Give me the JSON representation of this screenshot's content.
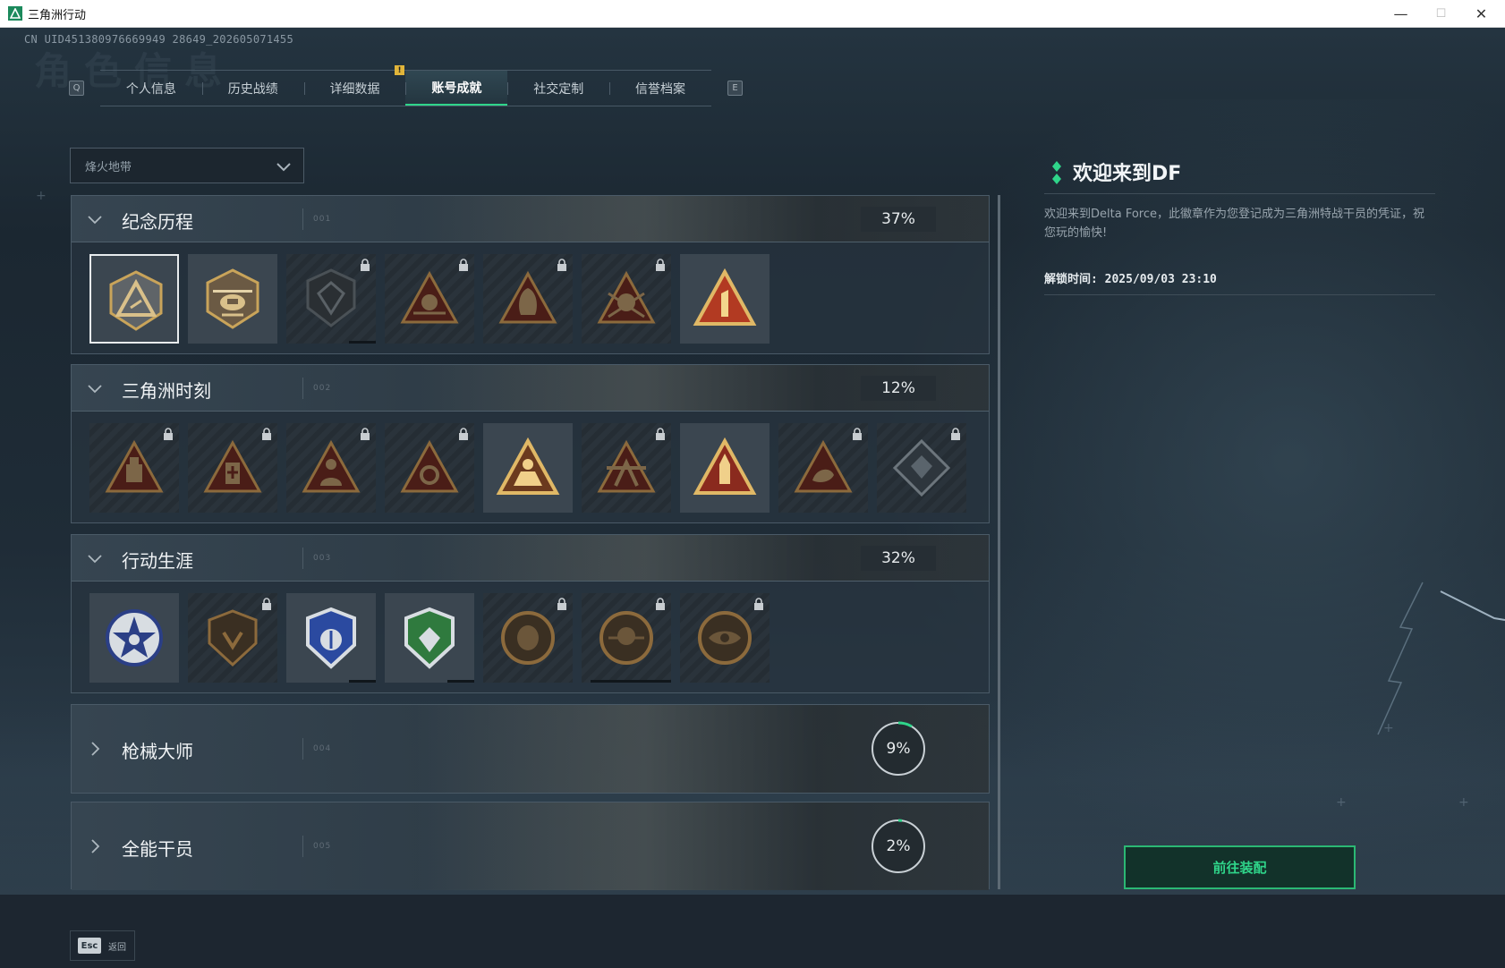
{
  "window": {
    "title": "三角洲行动",
    "controls": {
      "minimize": "—",
      "maximize": "☐",
      "close": "✕"
    }
  },
  "uid": "CN UID451380976669949 28649_202605071455",
  "background_title": "角色信息",
  "tabs": {
    "prev_key": "Q",
    "next_key": "E",
    "items": [
      {
        "label": "个人信息",
        "active": false
      },
      {
        "label": "历史战绩",
        "active": false
      },
      {
        "label": "详细数据",
        "active": false
      },
      {
        "label": "账号成就",
        "active": true
      },
      {
        "label": "社交定制",
        "active": false
      },
      {
        "label": "信誉档案",
        "active": false
      }
    ],
    "notice_badge": "!"
  },
  "mode_select": {
    "value": "烽火地带"
  },
  "sections": [
    {
      "title": "纪念历程",
      "number": "001",
      "expanded": true,
      "progress": "37%",
      "progress_value": 0.37,
      "badges": [
        {
          "name": "delta-triangle",
          "locked": false,
          "selected": true,
          "progress": null
        },
        {
          "name": "helicopter",
          "locked": false,
          "selected": false,
          "progress": null
        },
        {
          "name": "shield-crest",
          "locked": true,
          "selected": false,
          "progress": 0.3
        },
        {
          "name": "sniper-triangle",
          "locked": true,
          "selected": false,
          "progress": null
        },
        {
          "name": "hooded-triangle",
          "locked": true,
          "selected": false,
          "progress": null
        },
        {
          "name": "skull-triangle",
          "locked": true,
          "selected": false,
          "progress": null
        },
        {
          "name": "rank-one",
          "locked": false,
          "selected": false,
          "progress": null
        }
      ]
    },
    {
      "title": "三角洲时刻",
      "number": "002",
      "expanded": true,
      "progress": "12%",
      "progress_value": 0.12,
      "badges": [
        {
          "name": "robot-triangle",
          "locked": true,
          "progress": null
        },
        {
          "name": "medic-triangle",
          "locked": true,
          "progress": null
        },
        {
          "name": "soldier-triangle",
          "locked": true,
          "progress": null
        },
        {
          "name": "gear-triangle",
          "locked": true,
          "progress": null
        },
        {
          "name": "squad-triangle",
          "locked": false,
          "progress": null
        },
        {
          "name": "warrior-triangle",
          "locked": true,
          "progress": null
        },
        {
          "name": "rocket-triangle",
          "locked": false,
          "progress": null
        },
        {
          "name": "dragon-triangle",
          "locked": true,
          "progress": null
        },
        {
          "name": "crystal-diamond",
          "locked": true,
          "progress": null
        }
      ]
    },
    {
      "title": "行动生涯",
      "number": "003",
      "expanded": true,
      "progress": "32%",
      "progress_value": 0.32,
      "badges": [
        {
          "name": "star-wreath",
          "locked": false,
          "progress": null
        },
        {
          "name": "bronze-shield",
          "locked": true,
          "progress": null
        },
        {
          "name": "blue-eagle-shield",
          "locked": false,
          "progress": 0.25
        },
        {
          "name": "green-gem-shield",
          "locked": false,
          "progress": 0.5
        },
        {
          "name": "bronze-coin",
          "locked": true,
          "progress": null
        },
        {
          "name": "skull-coin",
          "locked": true,
          "progress": 0.9
        },
        {
          "name": "eye-coin",
          "locked": true,
          "progress": null
        }
      ]
    },
    {
      "title": "枪械大师",
      "number": "004",
      "expanded": false,
      "progress": "9%",
      "progress_value": 0.09
    },
    {
      "title": "全能干员",
      "number": "005",
      "expanded": false,
      "progress": "2%",
      "progress_value": 0.02
    }
  ],
  "detail": {
    "title": "欢迎来到DF",
    "description": "欢迎来到Delta Force，此徽章作为您登记成为三角洲特战干员的凭证，祝您玩的愉快!",
    "unlock_time": "解锁时间: 2025/09/03 23:10",
    "equip_button": "前往装配"
  },
  "footer": {
    "esc_key": "Esc",
    "back_label": "返回"
  },
  "colors": {
    "accent": "#2fd58a",
    "notice": "#e1b53a",
    "gold": "#c9a45a",
    "badge_red": "#8a2a1e"
  }
}
